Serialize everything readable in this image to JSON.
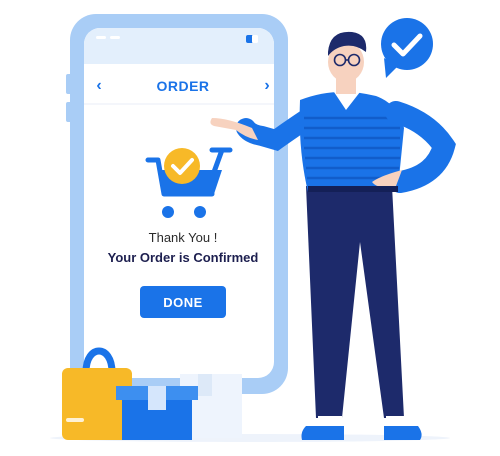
{
  "screen": {
    "title": "ORDER",
    "prev_glyph": "‹",
    "next_glyph": "›",
    "thank_you": "Thank You !",
    "confirmed": "Your Order is Confirmed",
    "done_label": "DONE"
  },
  "icons": [
    "cart-check-icon",
    "check-speech-bubble-icon",
    "status-pill-icon",
    "chevron-left-icon",
    "chevron-right-icon"
  ],
  "colors": {
    "primary_blue": "#1a73e8",
    "light_blue": "#cfe3fb",
    "navy": "#1d2a6b",
    "yellow": "#f7b928",
    "skin": "#f7d2bf"
  }
}
